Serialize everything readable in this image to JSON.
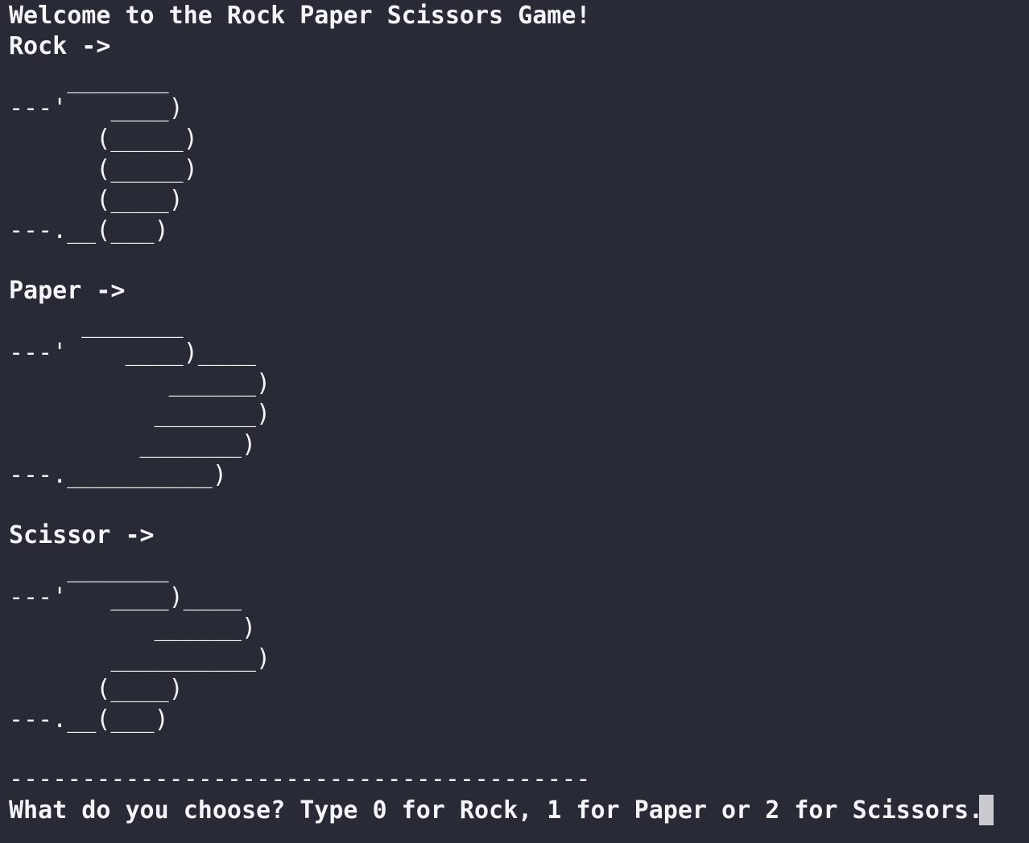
{
  "terminal": {
    "background": "#282a36",
    "foreground": "#f4f5f8",
    "cursor_color": "#c9cbd0",
    "welcome": "Welcome to the Rock Paper Scissors Game!",
    "rock_label": "Rock ->",
    "rock_art": [
      "    _______",
      "---'   ____)",
      "      (_____)",
      "      (_____)",
      "      (____)",
      "---.__(___)"
    ],
    "paper_label": "Paper ->",
    "paper_art": [
      "     _______",
      "---'    ____)____",
      "           ______)",
      "          _______)",
      "         _______)",
      "---.__________)"
    ],
    "scissor_label": "Scissor ->",
    "scissor_art": [
      "    _______",
      "---'   ____)____",
      "          ______)",
      "       __________)",
      "      (____)",
      "---.__(___)"
    ],
    "separator": "----------------------------------------",
    "prompt": "What do you choose? Type 0 for Rock, 1 for Paper or 2 for Scissors."
  }
}
